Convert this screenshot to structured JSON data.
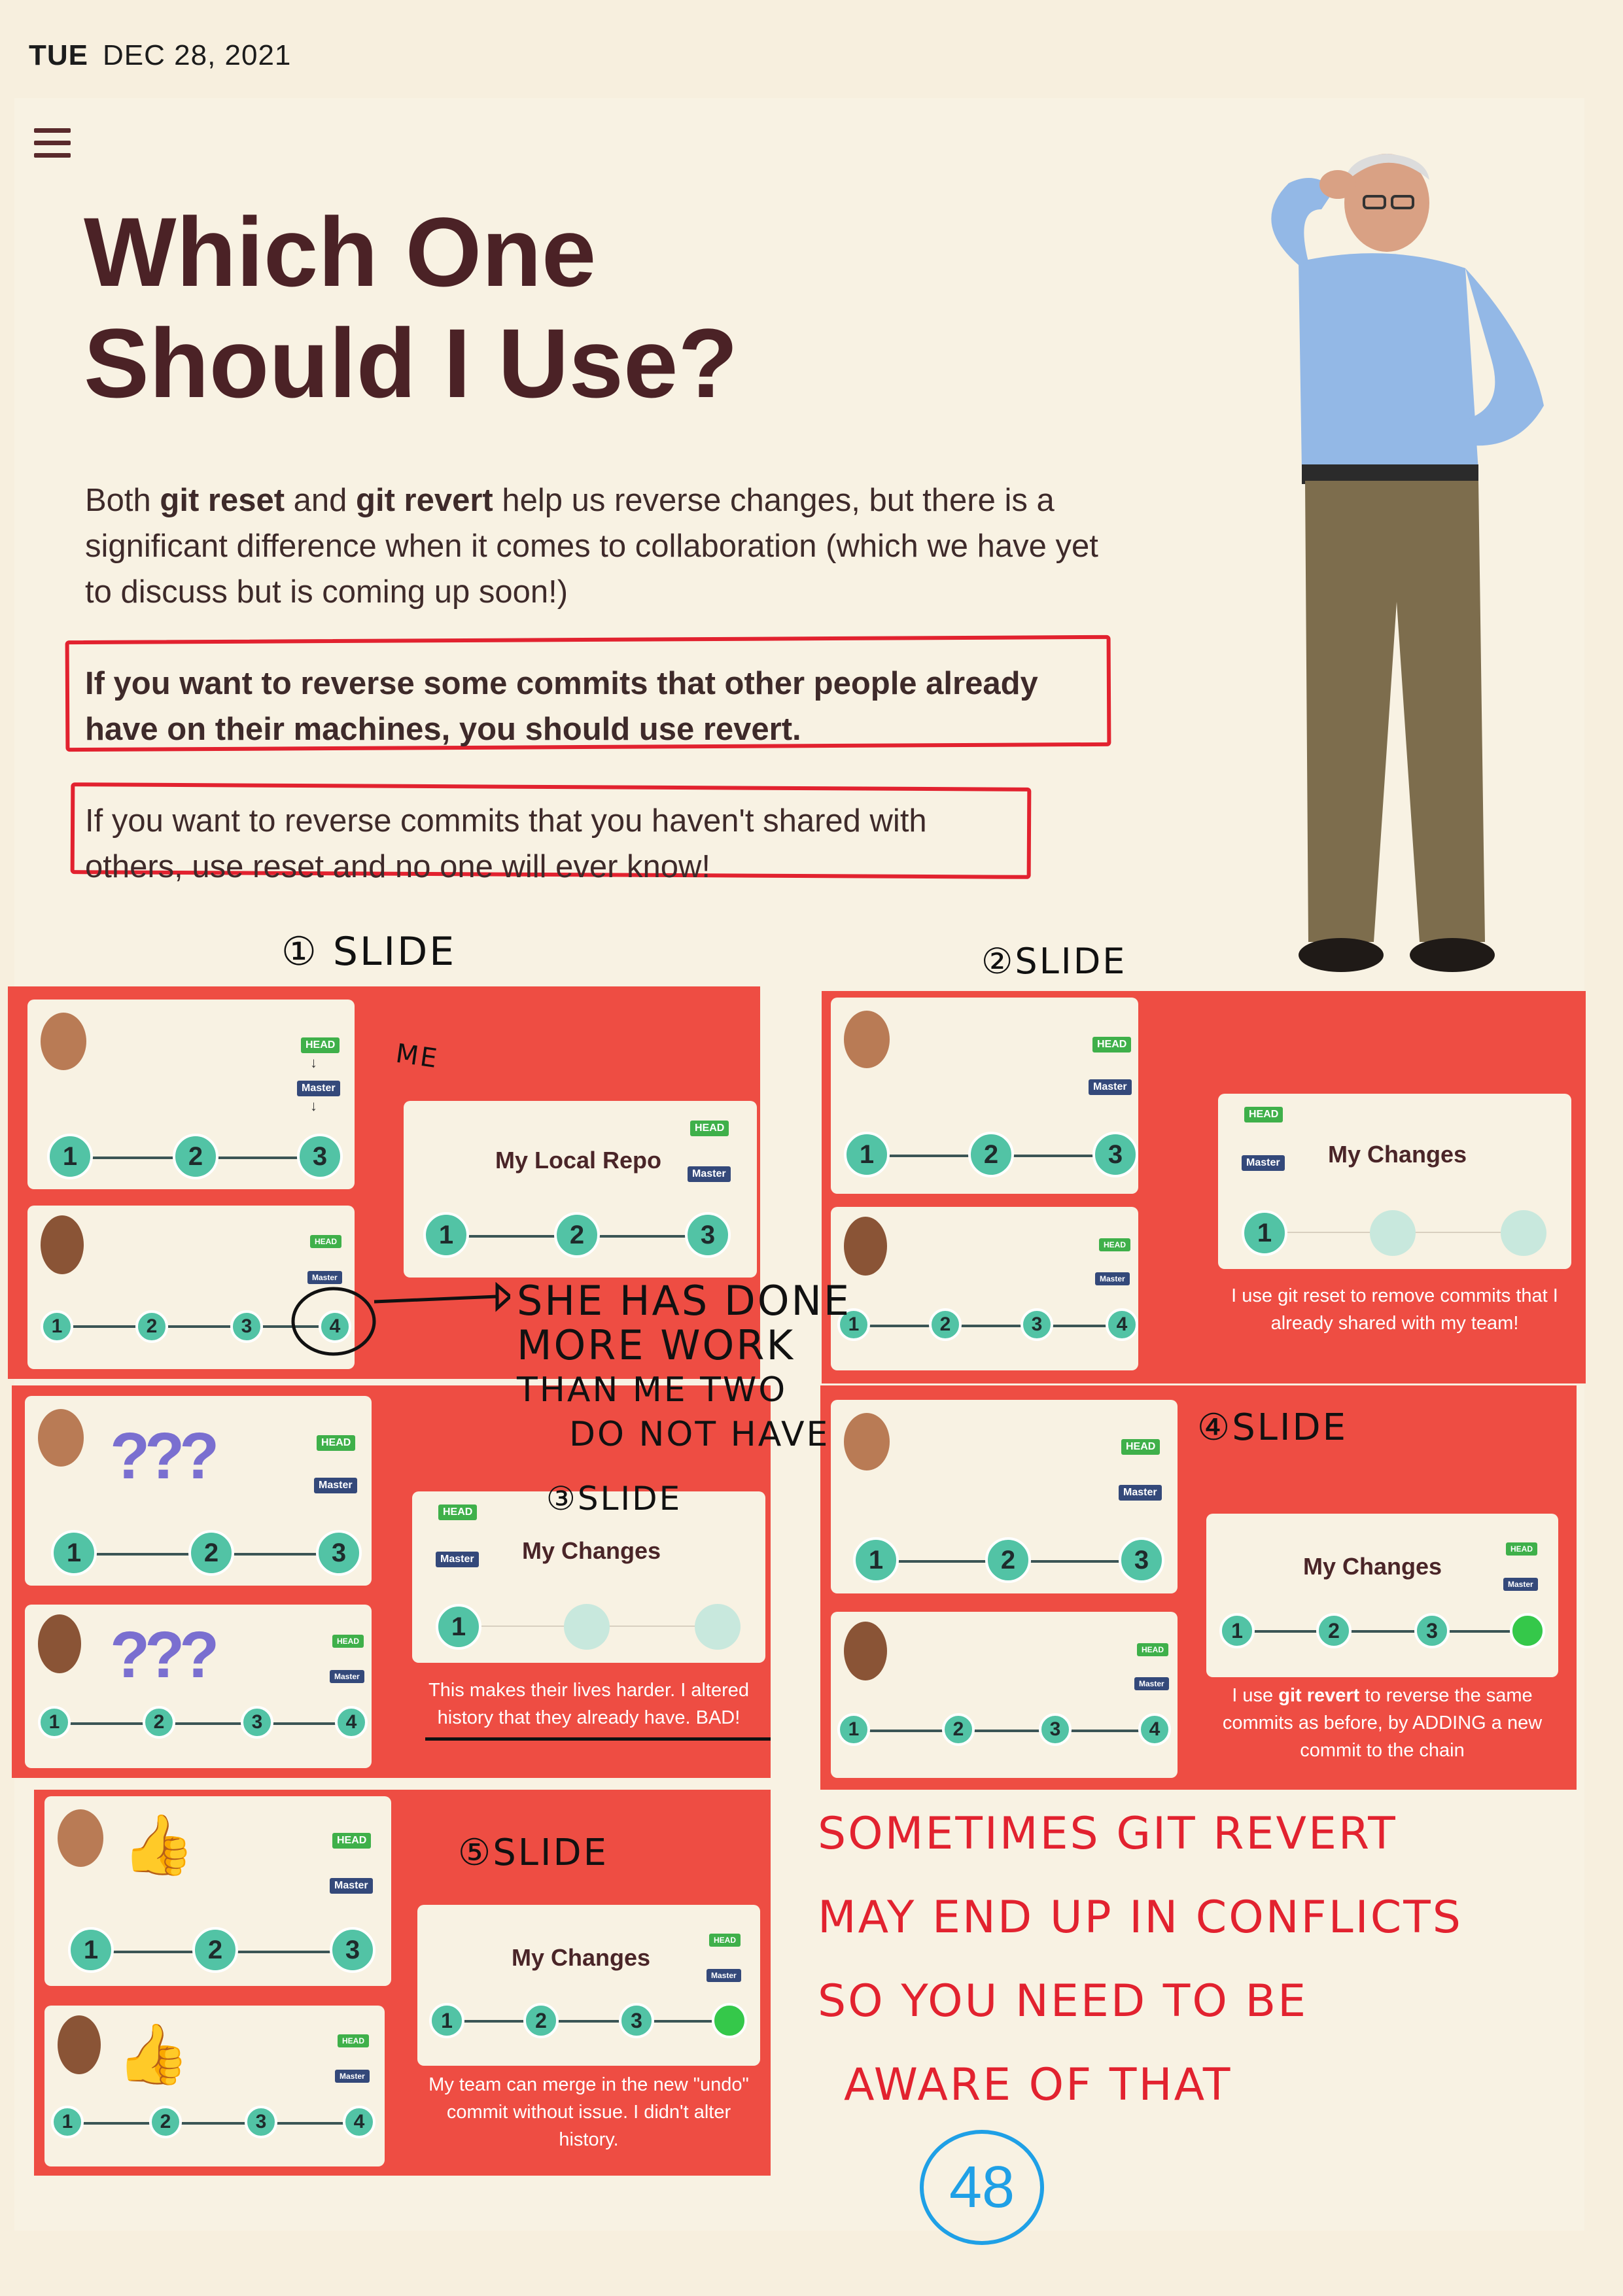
{
  "header": {
    "day": "TUE",
    "date": "DEC 28, 2021"
  },
  "icons": {
    "menu": "hamburger-icon"
  },
  "title": {
    "line1": "Which One",
    "line2": "Should I Use?"
  },
  "paragraphs": {
    "intro_1": "Both ",
    "intro_reset": "git reset",
    "intro_2": " and ",
    "intro_revert": "git revert",
    "intro_3": " help us reverse changes, but there is a significant difference when it comes to collaboration (which we have yet to discuss but is coming up soon!)",
    "bold_note": "If you want to reverse some commits that other people already have on their machines, you should use revert.",
    "reset_note": "If you want to reverse commits that you haven't shared with others, use reset and no one will ever know!"
  },
  "labels": {
    "head": "HEAD",
    "master": "Master"
  },
  "slides": {
    "s1_title": "My Local Repo",
    "s2_title": "My Changes",
    "s2_caption": "I use git reset to remove commits that I already shared with my team!",
    "s3_title": "My Changes",
    "s3_caption": "This makes their lives harder.  I altered history that they already have.  BAD!",
    "s4_title": "My Changes",
    "s4_caption_pre": "I use ",
    "s4_caption_bold": "git revert",
    "s4_caption_post": " to reverse the same commits as before, by  ADDING a new commit to the chain",
    "s5_title": "My Changes",
    "s5_caption": "My team can merge in the new \"undo\" commit without issue. I didn't alter history.",
    "question_marks": "???"
  },
  "commits": {
    "c1": "1",
    "c2": "2",
    "c3": "3",
    "c4": "4"
  },
  "handwriting": {
    "slide1": "① SLIDE",
    "slide2": "②SLIDE",
    "slide3": "③SLIDE",
    "slide4": "④SLIDE",
    "slide5": "⑤SLIDE",
    "me": "ME",
    "she_note_1": "SHE HAS DONE",
    "she_note_2": "MORE WORK",
    "she_note_3": "THAN ME TWO",
    "she_note_4": "DO NOT HAVE",
    "red_1": "SOMETIMES GIT REVERT",
    "red_2": "MAY  END  UP  IN  CONFLICTS",
    "red_3": "SO  YOU  NEED  TO  BE",
    "red_4": "AWARE  OF  THAT",
    "page_number": "48"
  },
  "colors": {
    "slide_bg": "#ee4d43",
    "node": "#52c3a5",
    "annotation_red": "#e2222f",
    "annotation_blue": "#1fa0e6",
    "title": "#4b2226"
  }
}
